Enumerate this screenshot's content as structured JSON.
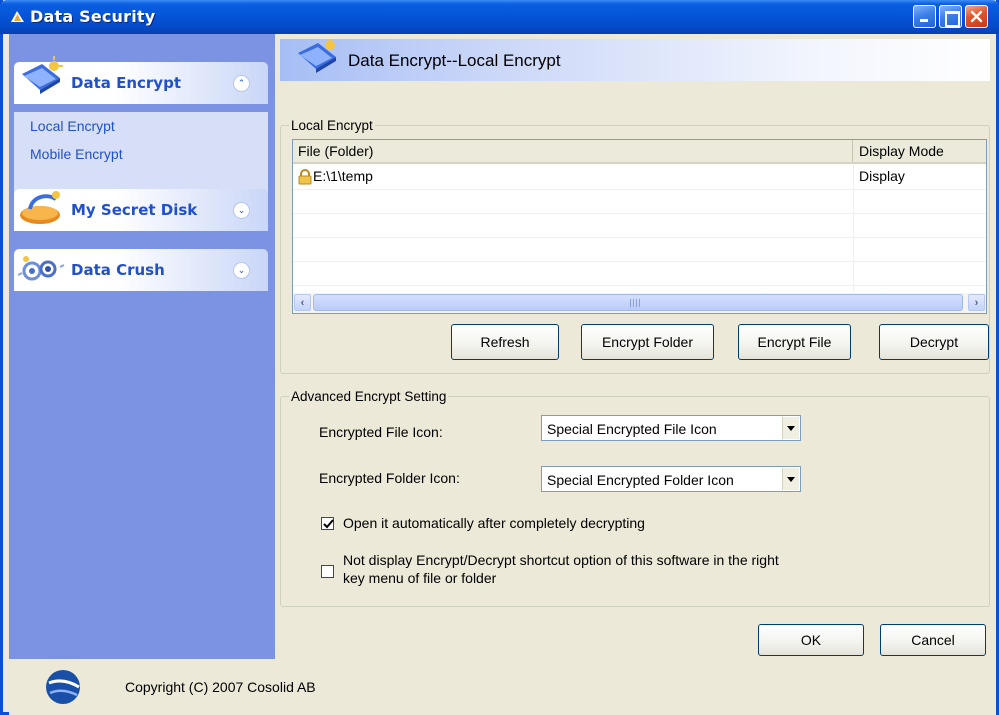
{
  "window": {
    "title": "Data Security",
    "controls": [
      "minimize-icon",
      "maximize-icon",
      "close-icon"
    ]
  },
  "sidebar": {
    "groups": [
      {
        "label": "Data Encrypt",
        "icon": "data-encrypt-icon",
        "expanded": true,
        "items": [
          {
            "label": "Local Encrypt"
          },
          {
            "label": "Mobile Encrypt"
          }
        ]
      },
      {
        "label": "My Secret Disk",
        "icon": "secret-disk-icon",
        "expanded": false
      },
      {
        "label": "Data Crush",
        "icon": "data-crush-icon",
        "expanded": false
      }
    ]
  },
  "content": {
    "header_title": "Data Encrypt--Local Encrypt",
    "local_encrypt": {
      "legend": "Local Encrypt",
      "columns": [
        "File (Folder)",
        "Display Mode"
      ],
      "rows": [
        {
          "file": "E:\\1\\temp",
          "mode": "Display",
          "icon": "lock-icon"
        }
      ],
      "buttons": {
        "refresh": "Refresh",
        "encrypt_folder": "Encrypt Folder",
        "encrypt_file": "Encrypt File",
        "decrypt": "Decrypt"
      }
    },
    "advanced": {
      "legend": "Advanced Encrypt Setting",
      "file_icon_label": "Encrypted File Icon:",
      "file_icon_value": "Special Encrypted File Icon",
      "folder_icon_label": "Encrypted Folder Icon:",
      "folder_icon_value": "Special Encrypted Folder Icon",
      "auto_open_label": "Open it automatically after completely decrypting",
      "auto_open_checked": true,
      "hide_shortcut_label_line1": "Not display Encrypt/Decrypt shortcut option of this software in the right",
      "hide_shortcut_label_line2": "key menu of file or folder",
      "hide_shortcut_checked": false
    },
    "ok_label": "OK",
    "cancel_label": "Cancel"
  },
  "status": {
    "copyright": "Copyright (C) 2007 Cosolid AB"
  },
  "colors": {
    "titlebar": "#0554d6",
    "sidebar_bg": "#7b93e2",
    "sidebar_link": "#2150c8",
    "panel_bg": "#ece9d8"
  }
}
